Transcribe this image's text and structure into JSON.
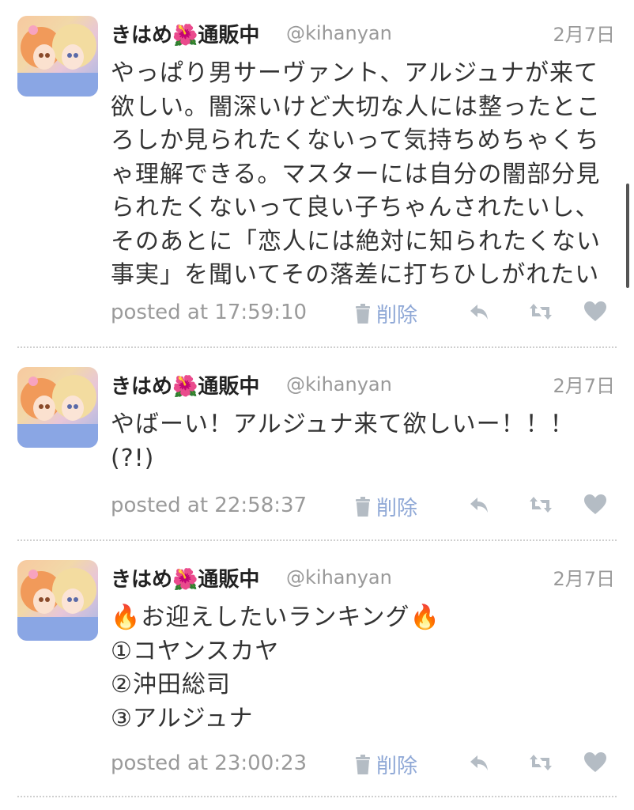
{
  "colors": {
    "name": "#222222",
    "muted": "#999999",
    "delete_accent": "#8fa8d6",
    "icon": "#b4bcc4",
    "divider": "#cfcfcf"
  },
  "tweets": [
    {
      "display_name": "きはめ🌺通販中",
      "handle": "@kihanyan",
      "date": "2月7日",
      "lines": [
        "やっぱり男サーヴァント、アルジュナが来て",
        "欲しい。闇深いけど大切な人には整ったとこ",
        "ろしか見られたくないって気持ちめちゃくち",
        "ゃ理解できる。マスターには自分の闇部分見",
        "られたくないって良い子ちゃんされたいし、",
        "そのあとに「恋人には絶対に知られたくない",
        "事実」を聞いてその落差に打ちひしがれたい"
      ],
      "posted": "posted at 17:59:10",
      "delete_label": "削除"
    },
    {
      "display_name": "きはめ🌺通販中",
      "handle": "@kihanyan",
      "date": "2月7日",
      "lines": [
        "やばーい！アルジュナ来て欲しいー！！！",
        "(?!)"
      ],
      "posted": "posted at 22:58:37",
      "delete_label": "削除"
    },
    {
      "display_name": "きはめ🌺通販中",
      "handle": "@kihanyan",
      "date": "2月7日",
      "lines": [
        "🔥お迎えしたいランキング🔥",
        "①コヤンスカヤ",
        "②沖田総司",
        "③アルジュナ"
      ],
      "posted": "posted at 23:00:23",
      "delete_label": "削除"
    }
  ],
  "icons": {
    "avatar": "avatar-image",
    "trash": "trash-icon",
    "reply": "reply-icon",
    "retweet": "retweet-icon",
    "like": "heart-icon"
  }
}
